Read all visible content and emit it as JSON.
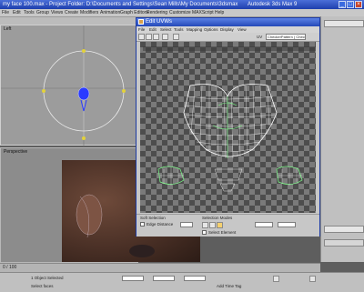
{
  "window": {
    "title": "my face 100.max  -  Project Folder: D:\\Documents and Settings\\Sean Mills\\My Documents\\3dsmax",
    "app_name": "Autodesk 3ds Max 9",
    "minimize_glyph": "_",
    "maximize_glyph": "□",
    "close_glyph": "×"
  },
  "menubar": {
    "items": [
      "File",
      "Edit",
      "Tools",
      "Group",
      "Views",
      "Create",
      "Modifiers",
      "Animation",
      "Graph Editors",
      "Rendering",
      "Customize",
      "MAXScript",
      "Help"
    ]
  },
  "viewports": {
    "left_label": "Left",
    "perspective_label": "Perspective"
  },
  "uvw_dialog": {
    "title": "Edit UVWs",
    "menu": [
      "File",
      "Edit",
      "Select",
      "Tools",
      "Mapping",
      "Options",
      "Display",
      "View"
    ],
    "map_dropdown": "CheckerPattern ( Checker )",
    "uv_label": "UV",
    "bottom": {
      "soft_selection_label": "Soft Selection",
      "edge_distance_label": "Edge Distance",
      "select_element_label": "Select Element",
      "selection_modes_label": "Selection Modes"
    }
  },
  "timeline": {
    "frame_counter": "0 / 100"
  },
  "statusbar": {
    "selection_text": "1 Object Selected",
    "prompt_text": "Select faces",
    "add_time_tag": "Add Time Tag"
  },
  "colors": {
    "titlebar_accent": "#2449b8",
    "uv_mesh": "#ffffff",
    "uv_highlight": "#7dff8a",
    "gizmo_yellow": "#e3d23a",
    "selection_blue": "#2a3bff"
  },
  "icons": [
    "minimize-icon",
    "maximize-icon",
    "close-icon",
    "uvw-app-icon",
    "move-icon",
    "rotate-icon",
    "scale-icon",
    "mirror-icon",
    "pan-icon",
    "zoom-icon"
  ]
}
